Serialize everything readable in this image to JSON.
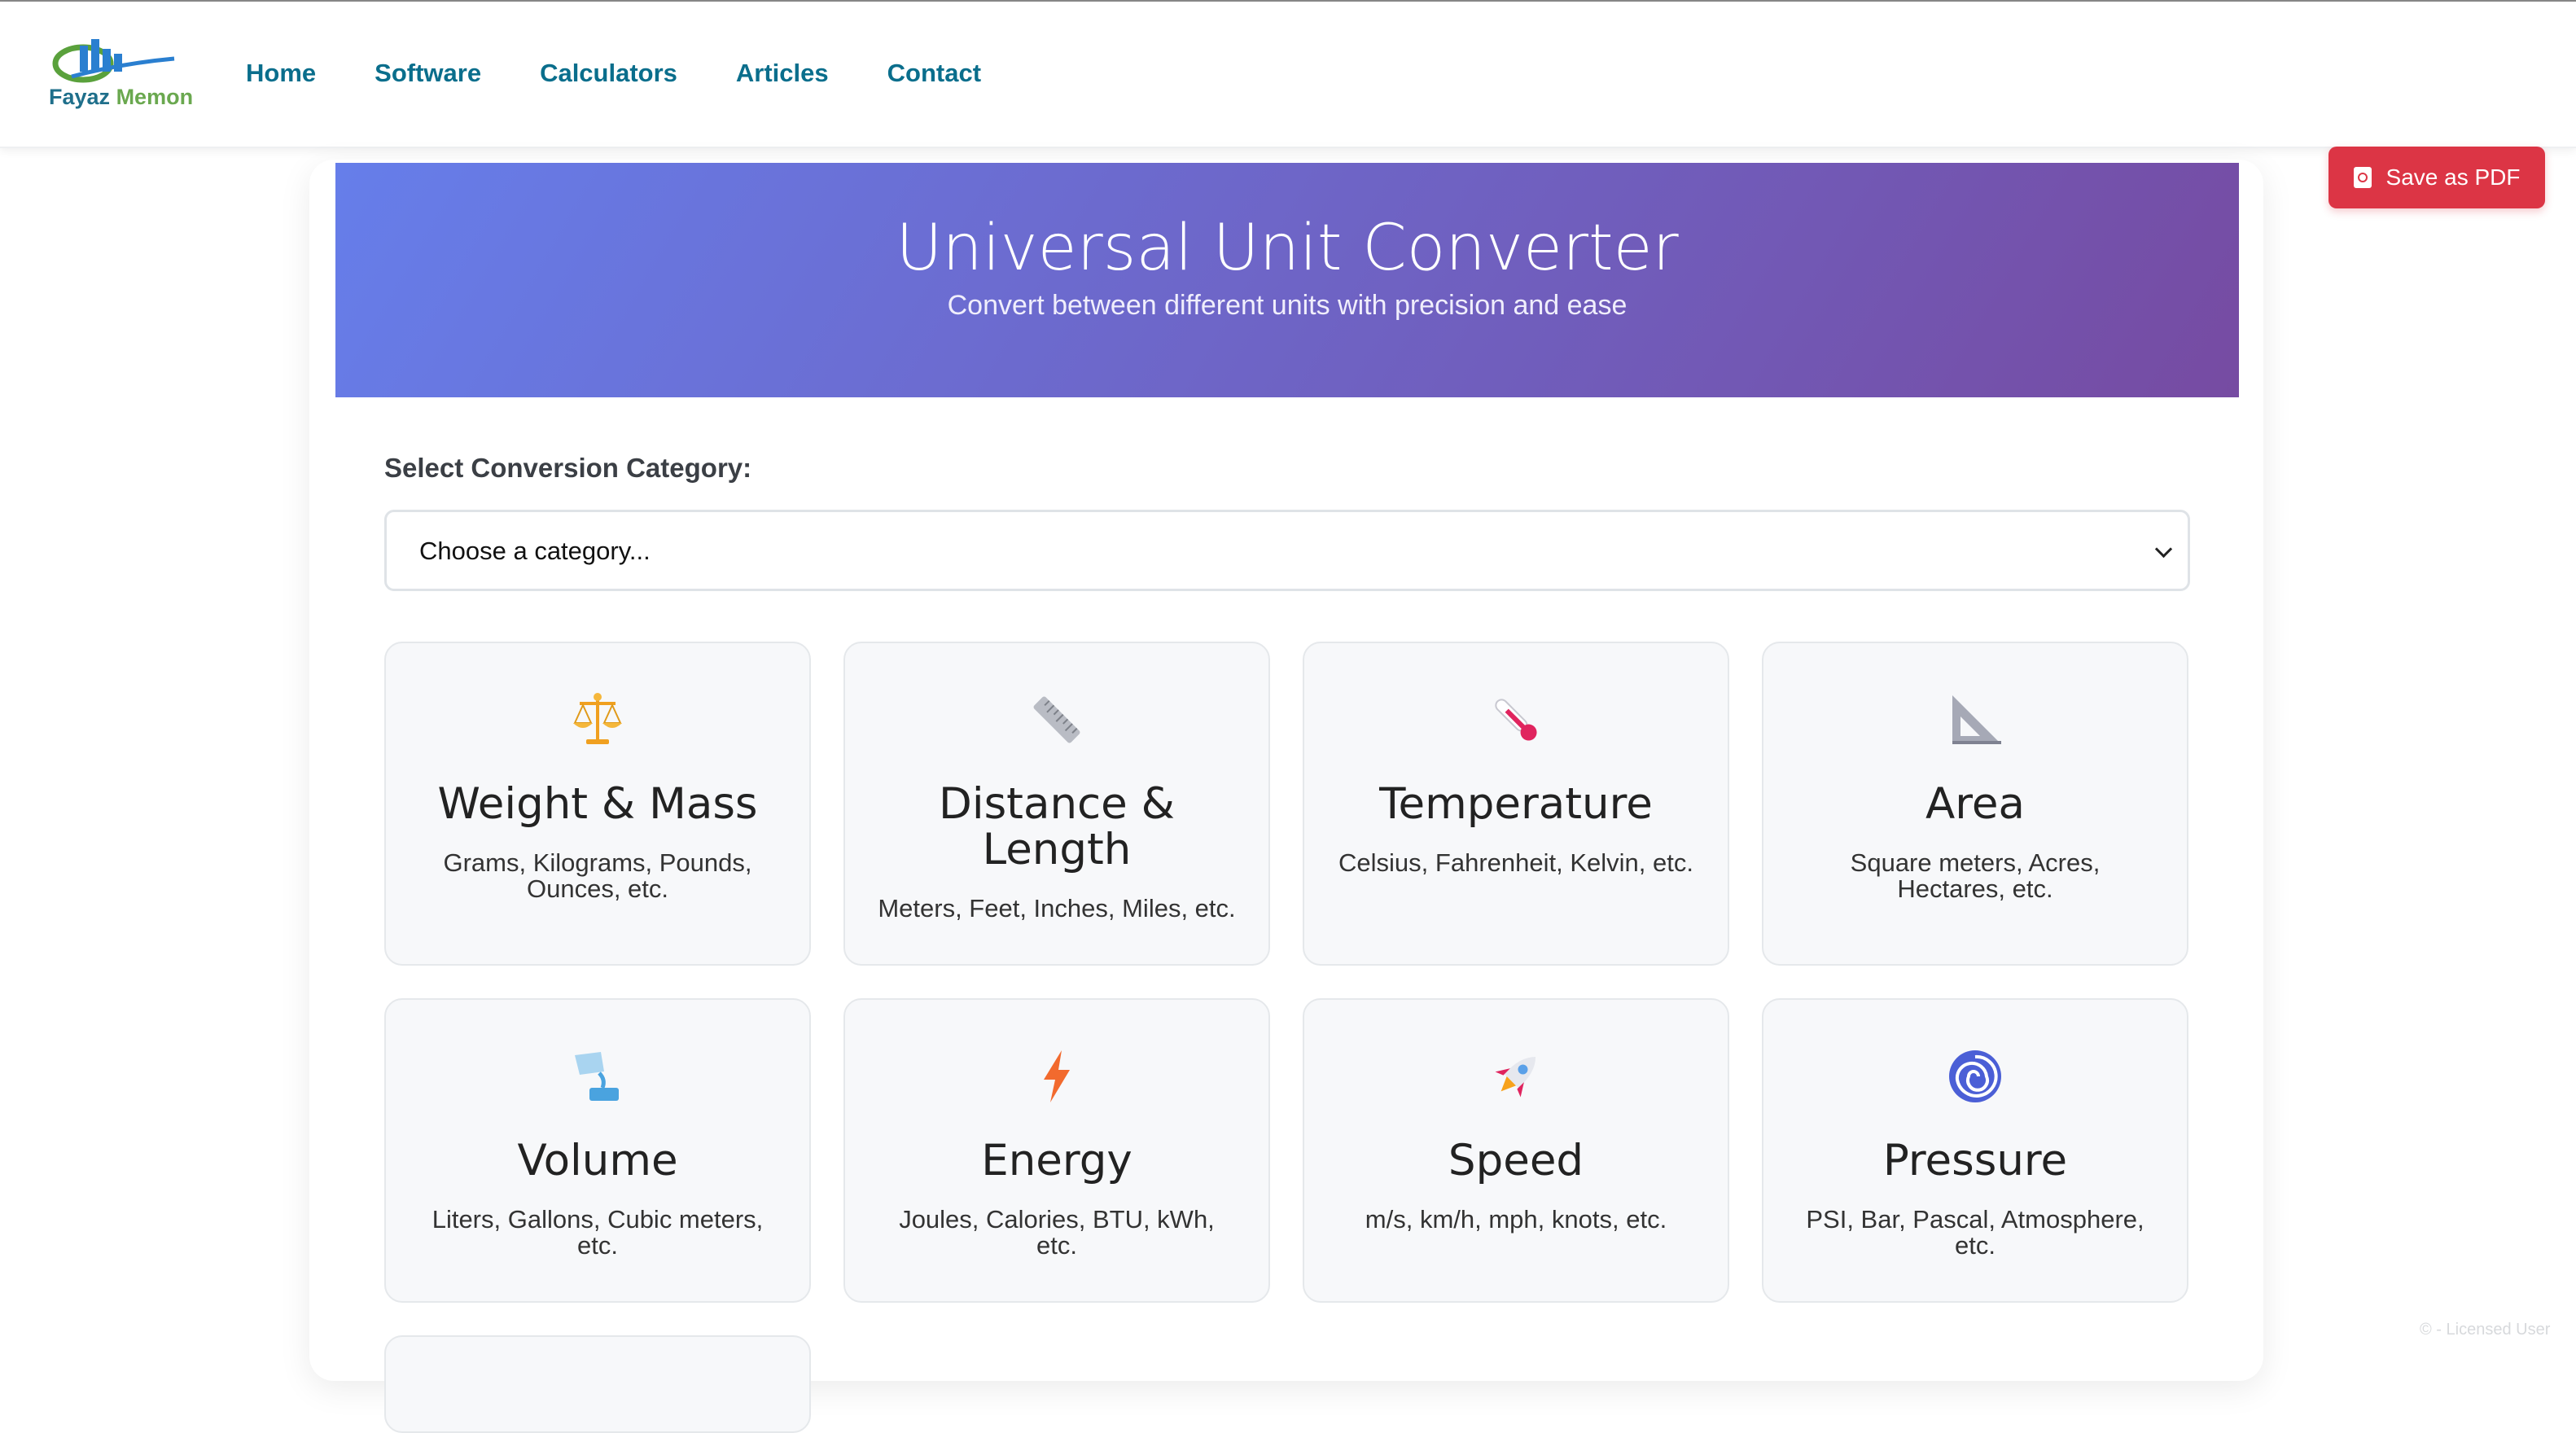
{
  "brand": {
    "name_part1": "Fayaz",
    "name_part2": "Memon"
  },
  "nav": {
    "items": [
      "Home",
      "Software",
      "Calculators",
      "Articles",
      "Contact"
    ]
  },
  "pdf_button": {
    "label": "Save as PDF"
  },
  "hero": {
    "title": "Universal Unit Converter",
    "subtitle": "Convert between different units with precision and ease"
  },
  "selector": {
    "label": "Select Conversion Category:",
    "selected_value": "Choose a category..."
  },
  "categories": [
    {
      "icon": "balance-scale-icon",
      "title": "Weight & Mass",
      "desc": "Grams, Kilograms, Pounds, Ounces, etc."
    },
    {
      "icon": "ruler-icon",
      "title": "Distance & Length",
      "desc": "Meters, Feet, Inches, Miles, etc."
    },
    {
      "icon": "thermometer-icon",
      "title": "Temperature",
      "desc": "Celsius, Fahrenheit, Kelvin, etc."
    },
    {
      "icon": "triangular-ruler-icon",
      "title": "Area",
      "desc": "Square meters, Acres, Hectares, etc."
    },
    {
      "icon": "pouring-liquid-icon",
      "title": "Volume",
      "desc": "Liters, Gallons, Cubic meters, etc."
    },
    {
      "icon": "lightning-icon",
      "title": "Energy",
      "desc": "Joules, Calories, BTU, kWh, etc."
    },
    {
      "icon": "rocket-icon",
      "title": "Speed",
      "desc": "m/s, km/h, mph, knots, etc."
    },
    {
      "icon": "cyclone-icon",
      "title": "Pressure",
      "desc": "PSI, Bar, Pascal, Atmosphere, etc."
    }
  ],
  "watermark": "© - Licensed User",
  "colors": {
    "nav_link": "#0a6e8c",
    "hero_start": "#667eea",
    "hero_end": "#764ba2",
    "pdf_button": "#dc3545"
  }
}
